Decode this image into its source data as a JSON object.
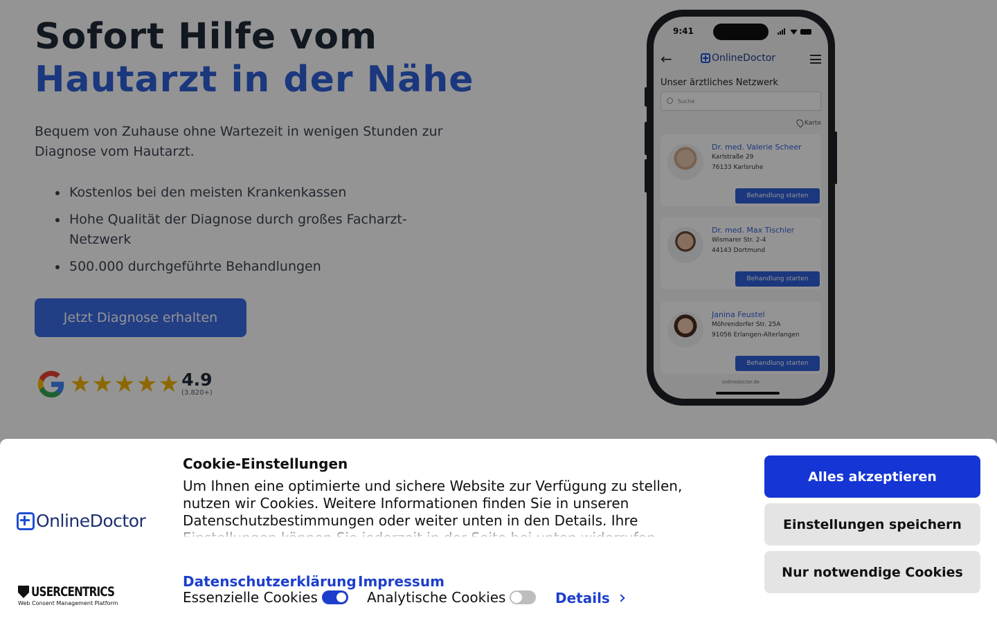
{
  "hero": {
    "headline_line1": "Sofort Hilfe vom",
    "headline_line2": "Hautarzt in der Nähe",
    "lead": "Bequem von Zuhause ohne Wartezeit in wenigen Stunden zur Diagnose vom Hautarzt.",
    "bullets": [
      "Kostenlos bei den meisten Krankenkassen",
      "Hohe Qualität der Diagnose durch großes Facharzt-Netzwerk",
      "500.000 durchgeführte Behandlungen"
    ],
    "cta_label": "Jetzt Diagnose erhalten",
    "rating": {
      "stars": 5,
      "value": "4.9",
      "count": "(3.820+)"
    }
  },
  "phone": {
    "time": "9:41",
    "app_name": "OnlineDoctor",
    "network_title": "Unser ärztliches Netzwerk",
    "search_placeholder": "Suche",
    "map_label": "Karte",
    "doctors": [
      {
        "name": "Dr. med. Valerie Scheer",
        "street": "Karlstraße 29",
        "city": "76133 Karlsruhe",
        "button": "Behandlung starten"
      },
      {
        "name": "Dr. med. Max Tischler",
        "street": "Wismarer Str. 2-4",
        "city": "44143 Dortmund",
        "button": "Behandlung starten"
      },
      {
        "name": "Janina Feustel",
        "street": "Möhrendorfer Str. 25A",
        "city": "91056 Erlangen-Alterlangen",
        "button": "Behandlung starten"
      }
    ],
    "url": "onlinedoctor.de"
  },
  "cookie": {
    "brand": "OnlineDoctor",
    "title": "Cookie-Einstellungen",
    "text": "Um Ihnen eine optimierte und sichere Website zur Verfügung zu stellen, nutzen wir Cookies. Weitere Informationen finden Sie in unseren Datenschutzbestimmungen oder weiter unten in den Details. Ihre Einstellungen können Sie jederzeit in der Seite bei unten widerrufen.",
    "links": {
      "privacy": "Datenschutzerklärung",
      "imprint": "Impressum"
    },
    "toggles": {
      "essential_label": "Essenzielle Cookies",
      "essential_on": true,
      "analytics_label": "Analytische Cookies",
      "analytics_on": false
    },
    "details_label": "Details",
    "buttons": {
      "accept_all": "Alles akzeptieren",
      "save": "Einstellungen speichern",
      "necessary": "Nur notwendige Cookies"
    },
    "cmp": {
      "name": "USERCENTRICS",
      "tagline": "Web Consent Management Platform"
    },
    "colors": {
      "primary": "#1535d4",
      "link": "#1d3fcc"
    }
  }
}
